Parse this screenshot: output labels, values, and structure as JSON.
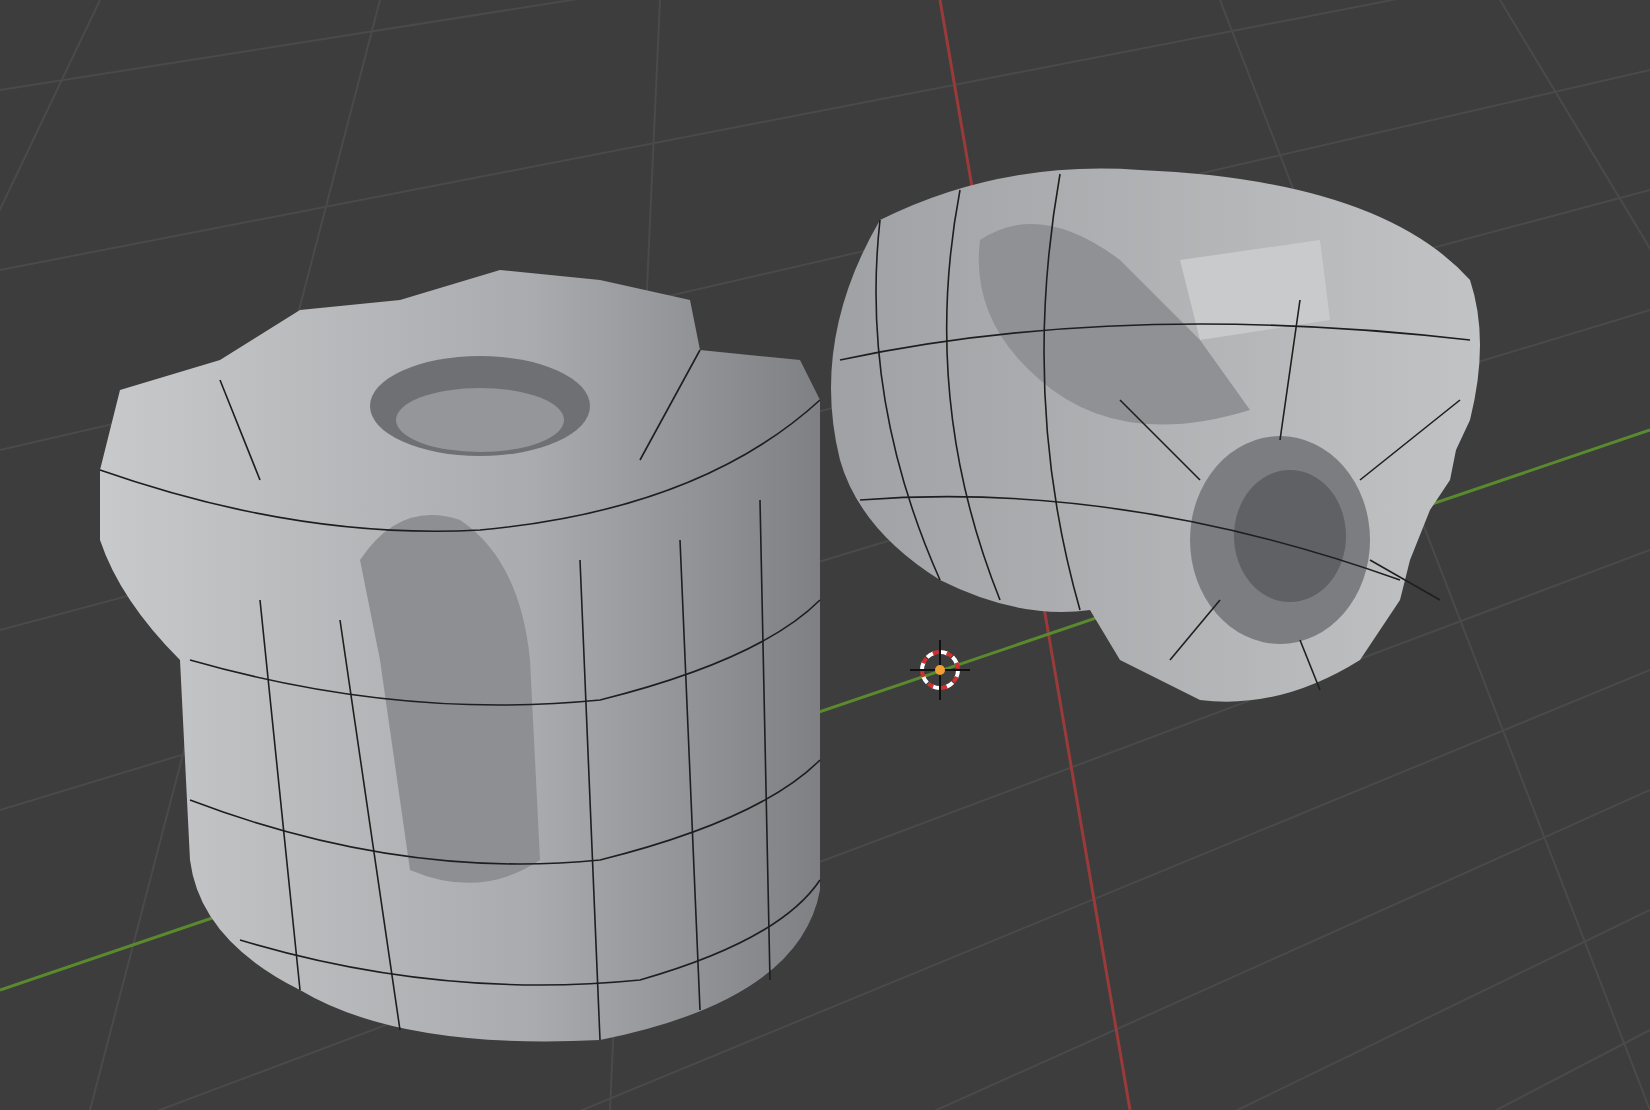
{
  "viewport": {
    "axes": [
      {
        "color": "#9a3a3a"
      },
      {
        "color": "#5a8a2e"
      }
    ]
  }
}
